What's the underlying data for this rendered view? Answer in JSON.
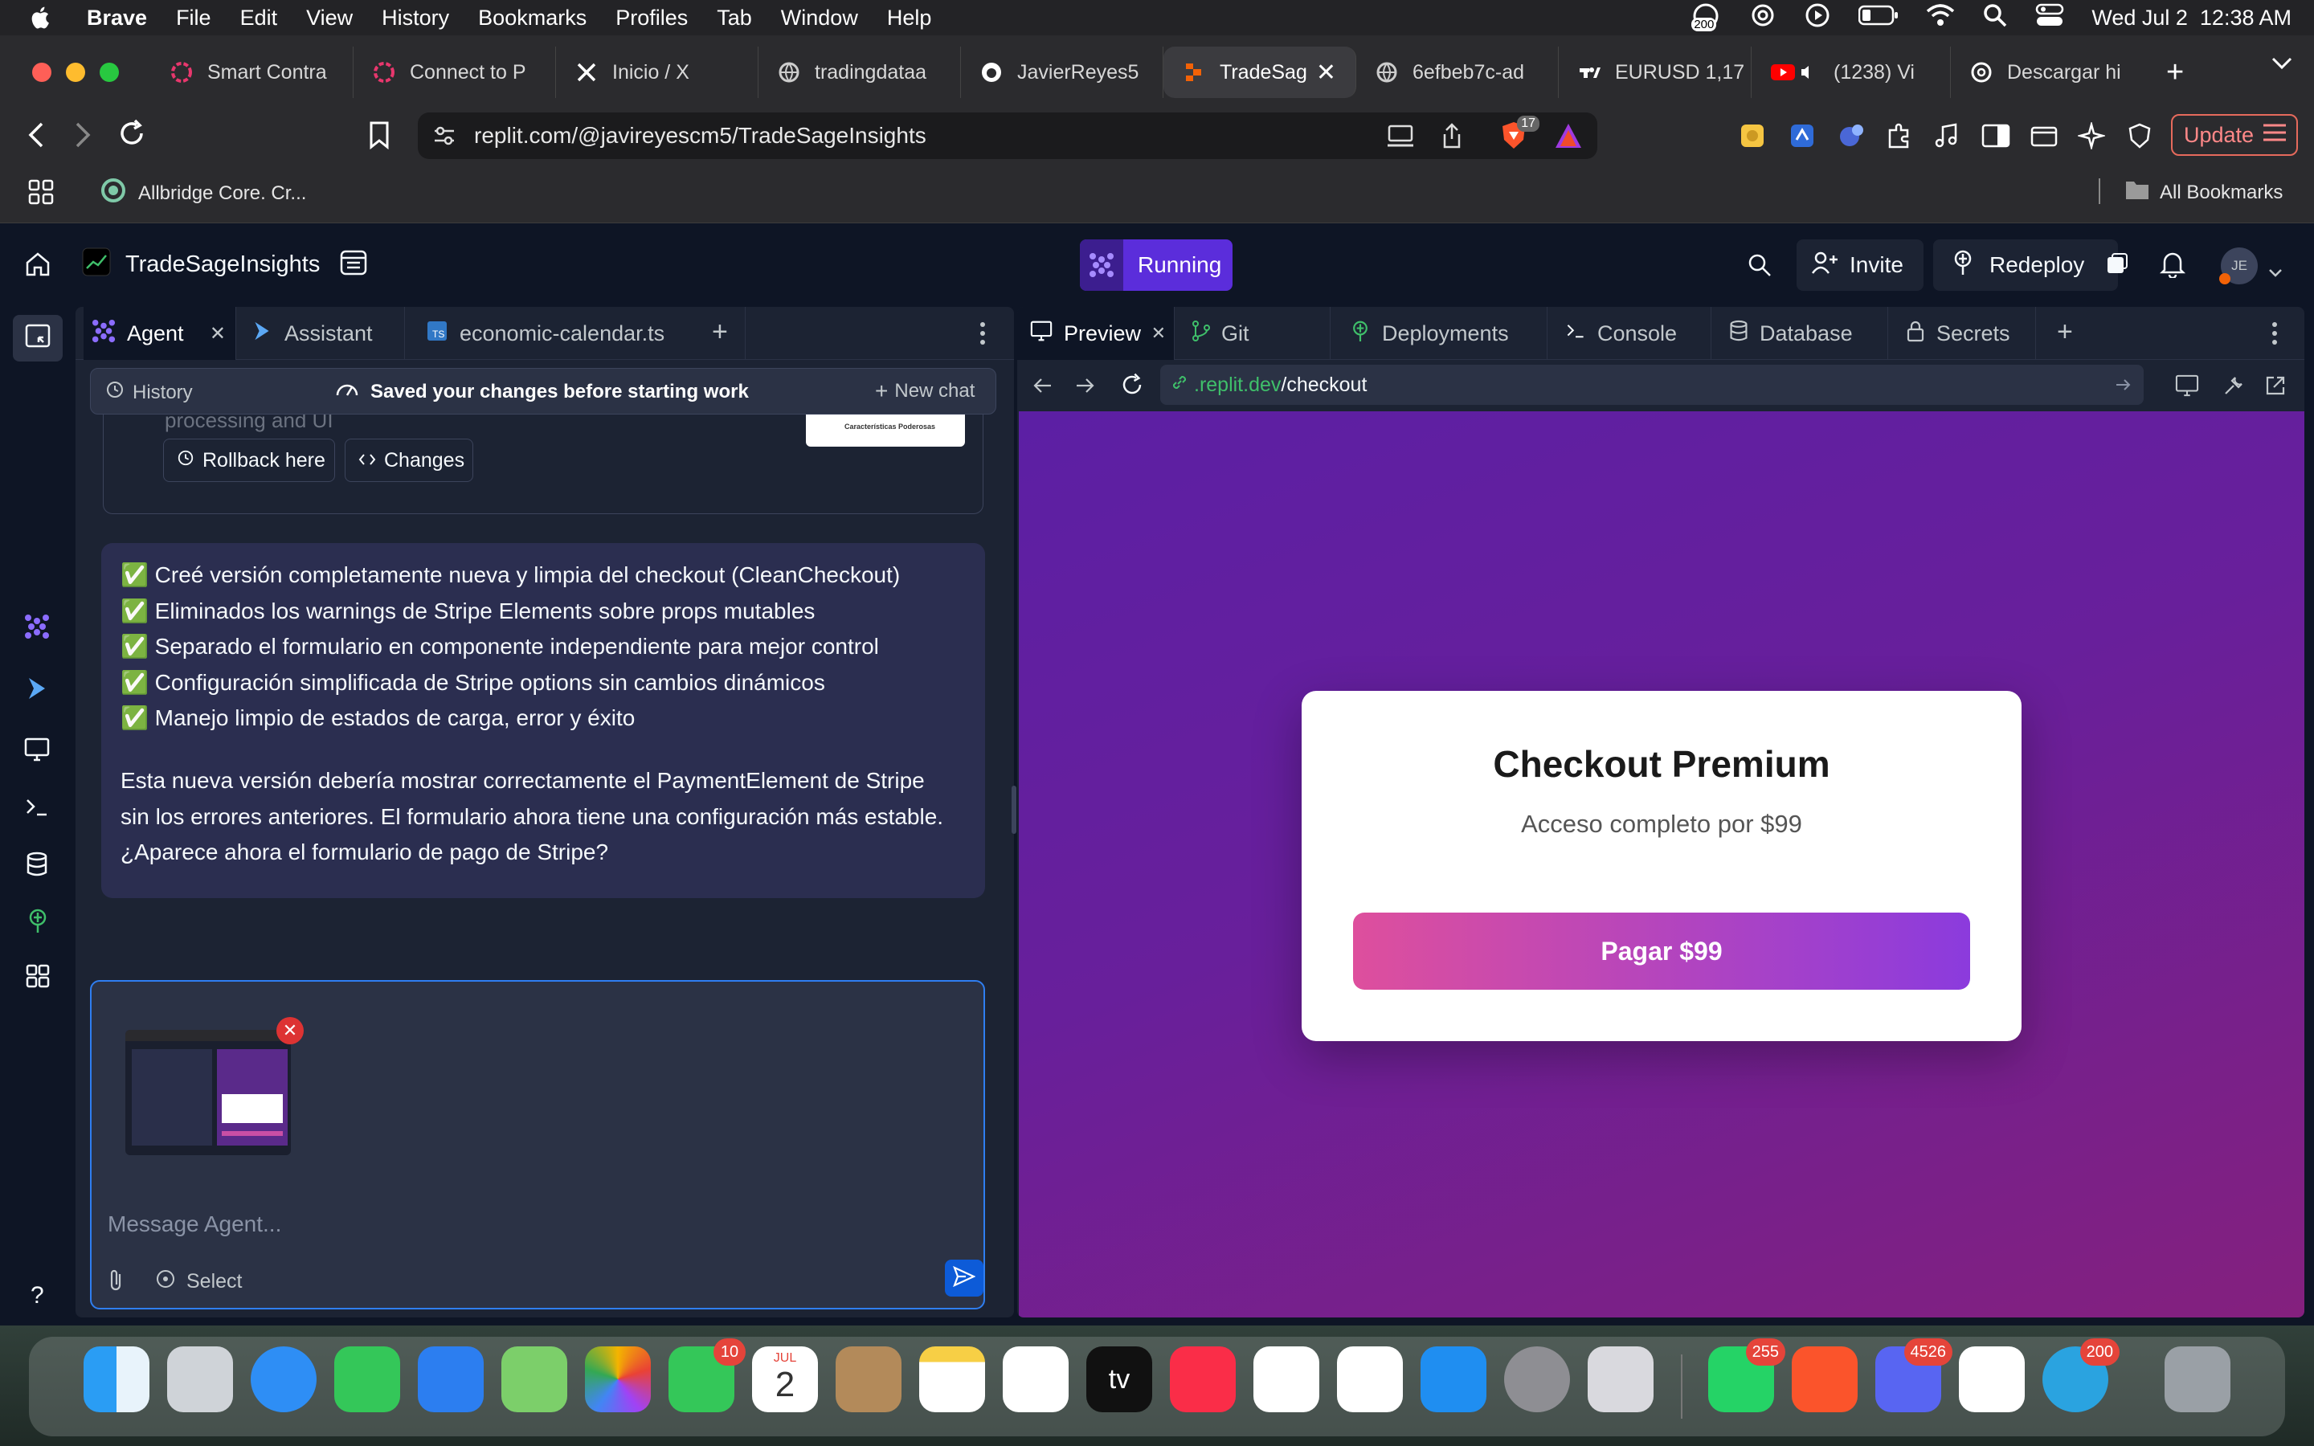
{
  "menubar": {
    "app": "Brave",
    "items": [
      "File",
      "Edit",
      "View",
      "History",
      "Bookmarks",
      "Profiles",
      "Tab",
      "Window",
      "Help"
    ],
    "badge": "200",
    "datetime": "Wed Jul 2  12:38 AM"
  },
  "browser": {
    "tabs": [
      {
        "title": "Smart Contra",
        "icon": "replit-icon"
      },
      {
        "title": "Connect to P",
        "icon": "replit-icon"
      },
      {
        "title": "Inicio / X",
        "icon": "x-icon"
      },
      {
        "title": "tradingdataa",
        "icon": "globe-icon"
      },
      {
        "title": "JavierReyes5",
        "icon": "github-icon"
      },
      {
        "title": "TradeSag",
        "icon": "replit-icon",
        "active": true
      },
      {
        "title": "6efbeb7c-ad",
        "icon": "globe-icon"
      },
      {
        "title": "EURUSD 1,17",
        "icon": "tradingview-icon"
      },
      {
        "title": "(1238) Vi",
        "icon": "youtube-icon"
      },
      {
        "title": "Descargar hi",
        "icon": "openai-icon"
      }
    ],
    "url": "replit.com/@javireyescm5/TradeSageInsights",
    "shield_count": "17",
    "update_label": "Update",
    "bookmark": "Allbridge Core. Cr...",
    "all_bookmarks": "All Bookmarks"
  },
  "replit": {
    "project_name": "TradeSageInsights",
    "status": "Running",
    "invite": "Invite",
    "redeploy": "Redeploy",
    "avatar": "JE",
    "left_tabs": [
      "Agent",
      "Assistant",
      "economic-calendar.ts"
    ],
    "history": "History",
    "saved_notice": "Saved your changes before starting work",
    "new_chat": "New chat",
    "partial_text": "processing and UI",
    "thumb_caption": "Características Poderosas",
    "rollback": "Rollback here",
    "changes": "Changes",
    "bullets": [
      "Creé versión completamente nueva y limpia del checkout (CleanCheckout)",
      "Eliminados los warnings de Stripe Elements sobre props mutables",
      "Separado el formulario en componente independiente para mejor control",
      "Configuración simplificada de Stripe options sin cambios dinámicos",
      "Manejo limpio de estados de carga, error y éxito"
    ],
    "paragraph": [
      "Esta nueva versión debería mostrar correctamente el PaymentElement de Stripe",
      "sin los errores anteriores. El formulario ahora tiene una configuración más estable.",
      "¿Aparece ahora el formulario de pago de Stripe?"
    ],
    "message_placeholder": "Message Agent...",
    "select": "Select",
    "right_tabs": [
      "Preview",
      "Git",
      "Deployments",
      "Console",
      "Database",
      "Secrets"
    ],
    "preview_url_host": ".replit.dev",
    "preview_url_path": "/checkout",
    "help": "?"
  },
  "checkout": {
    "title": "Checkout Premium",
    "subtitle": "Acceso completo por $99",
    "button": "Pagar $99"
  },
  "dock": {
    "facetime_badge": "10",
    "calendar_month": "JUL",
    "calendar_day": "2",
    "appletv": "tv",
    "whatsapp_badge": "255",
    "discord_badge": "4526",
    "telegram_badge": "200"
  },
  "colors": {
    "accent": "#5b2ddb",
    "checkout_gradient_start": "#de4f9d",
    "checkout_gradient_end": "#8b3bdd"
  }
}
